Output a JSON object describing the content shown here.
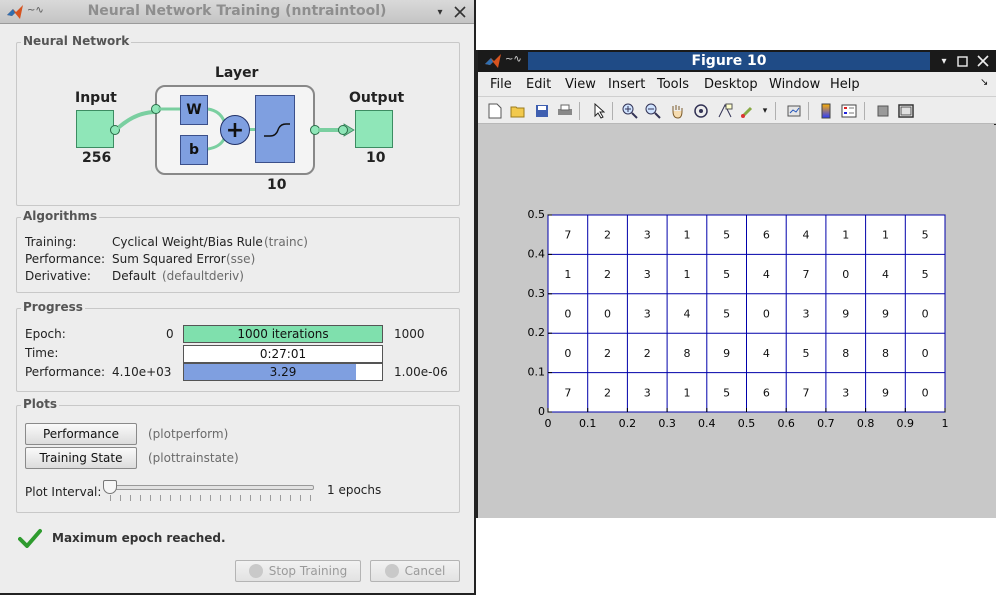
{
  "window1": {
    "title": "Neural Network Training (nntraintool)",
    "network": {
      "section_title": "Neural Network",
      "input_label": "Input",
      "input_size": "256",
      "layer_label": "Layer",
      "weight_label": "W",
      "bias_label": "b",
      "sum_symbol": "+",
      "layer_size": "10",
      "output_label": "Output",
      "output_size": "10"
    },
    "algorithms": {
      "section_title": "Algorithms",
      "rows": [
        {
          "label": "Training:",
          "value": "Cyclical Weight/Bias Rule",
          "func": "(trainc)"
        },
        {
          "label": "Performance:",
          "value": "Sum Squared Error",
          "func": "(sse)"
        },
        {
          "label": "Derivative:",
          "value": "Default",
          "func": "(defaultderiv)"
        }
      ]
    },
    "progress": {
      "section_title": "Progress",
      "epoch": {
        "label": "Epoch:",
        "min": "0",
        "text": "1000 iterations",
        "max": "1000",
        "fraction": 1.0,
        "color": "#7fe0ad"
      },
      "time": {
        "label": "Time:",
        "text": "0:27:01"
      },
      "performance": {
        "label": "Performance:",
        "min": "4.10e+03",
        "text": "3.29",
        "max": "1.00e-06",
        "fraction": 0.87,
        "color": "#7f9fe0"
      }
    },
    "plots": {
      "section_title": "Plots",
      "buttons": [
        {
          "label": "Performance",
          "func": "(plotperform)"
        },
        {
          "label": "Training State",
          "func": "(plottrainstate)"
        }
      ],
      "interval_label": "Plot Interval:",
      "interval_value": "1 epochs"
    },
    "status": {
      "text": "Maximum epoch reached."
    },
    "stop_button": "Stop Training",
    "cancel_button": "Cancel"
  },
  "window2": {
    "title": "Figure 10",
    "menu": [
      "File",
      "Edit",
      "View",
      "Insert",
      "Tools",
      "Desktop",
      "Window",
      "Help"
    ],
    "toolbar_icons": [
      "new-figure-icon",
      "open-file-icon",
      "save-icon",
      "print-icon",
      "pointer-icon",
      "zoom-in-icon",
      "zoom-out-icon",
      "pan-icon",
      "rotate-icon",
      "data-cursor-icon",
      "brush-icon",
      "link-plot-icon",
      "colorbar-icon",
      "legend-icon",
      "hide-plot-tools-icon",
      "show-plot-tools-icon"
    ]
  },
  "chart_data": {
    "type": "table",
    "title": "",
    "xlabel": "",
    "ylabel": "",
    "xlim": [
      0,
      1
    ],
    "ylim": [
      0,
      0.5
    ],
    "xticks": [
      "0",
      "0.1",
      "0.2",
      "0.3",
      "0.4",
      "0.5",
      "0.6",
      "0.7",
      "0.8",
      "0.9",
      "1"
    ],
    "yticks": [
      "0",
      "0.1",
      "0.2",
      "0.3",
      "0.4",
      "0.5"
    ],
    "grid_color": "#0000aa",
    "rows": [
      [
        "7",
        "2",
        "3",
        "1",
        "5",
        "6",
        "4",
        "1",
        "1",
        "5"
      ],
      [
        "1",
        "2",
        "3",
        "1",
        "5",
        "4",
        "7",
        "0",
        "4",
        "5"
      ],
      [
        "0",
        "0",
        "3",
        "4",
        "5",
        "0",
        "3",
        "9",
        "9",
        "0"
      ],
      [
        "0",
        "2",
        "2",
        "8",
        "9",
        "4",
        "5",
        "8",
        "8",
        "0"
      ],
      [
        "7",
        "2",
        "3",
        "1",
        "5",
        "6",
        "7",
        "3",
        "9",
        "0"
      ]
    ]
  }
}
